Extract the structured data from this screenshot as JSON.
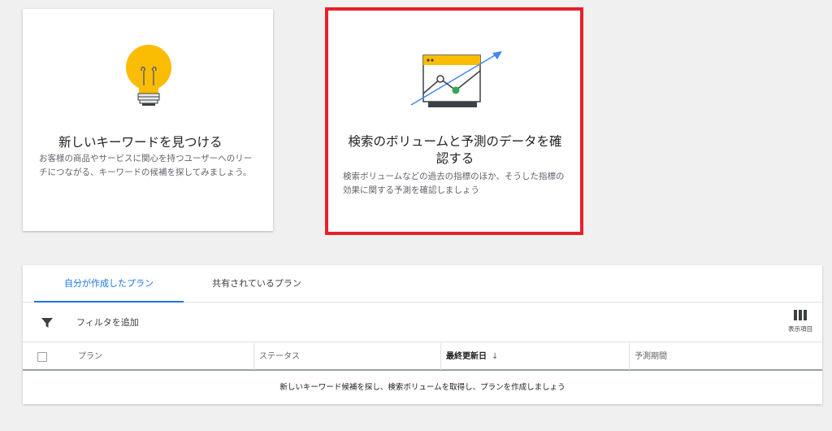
{
  "cards": {
    "find": {
      "title": "新しいキーワードを見つける",
      "desc": "お客様の商品やサービスに関心を持つユーザーへのリーチにつながる、キーワードの候補を探してみましょう。",
      "icon": "lightbulb-icon"
    },
    "forecast": {
      "title": "検索のボリュームと予測のデータを確認する",
      "desc": "検索ボリュームなどの過去の指標のほか、そうした指標の効果に関する予測を確認しましょう",
      "icon": "trend-chart-icon",
      "highlight_color": "#e8202a"
    }
  },
  "plans": {
    "tabs": [
      {
        "label": "自分が作成したプラン",
        "active": true
      },
      {
        "label": "共有されているプラン",
        "active": false
      }
    ],
    "filter_label": "フィルタを追加",
    "columns_label": "表示項目",
    "table": {
      "headers": [
        "プラン",
        "ステータス",
        "最終更新日",
        "予測期間"
      ],
      "sort_indicator": "↓",
      "empty_message": "新しいキーワード候補を探し、検索ボリュームを取得し、プランを作成しましょう"
    }
  },
  "colors": {
    "accent": "#1a73e8",
    "bulb": "#fbbc04",
    "green_dot": "#34a853",
    "arrow": "#4285f4"
  }
}
